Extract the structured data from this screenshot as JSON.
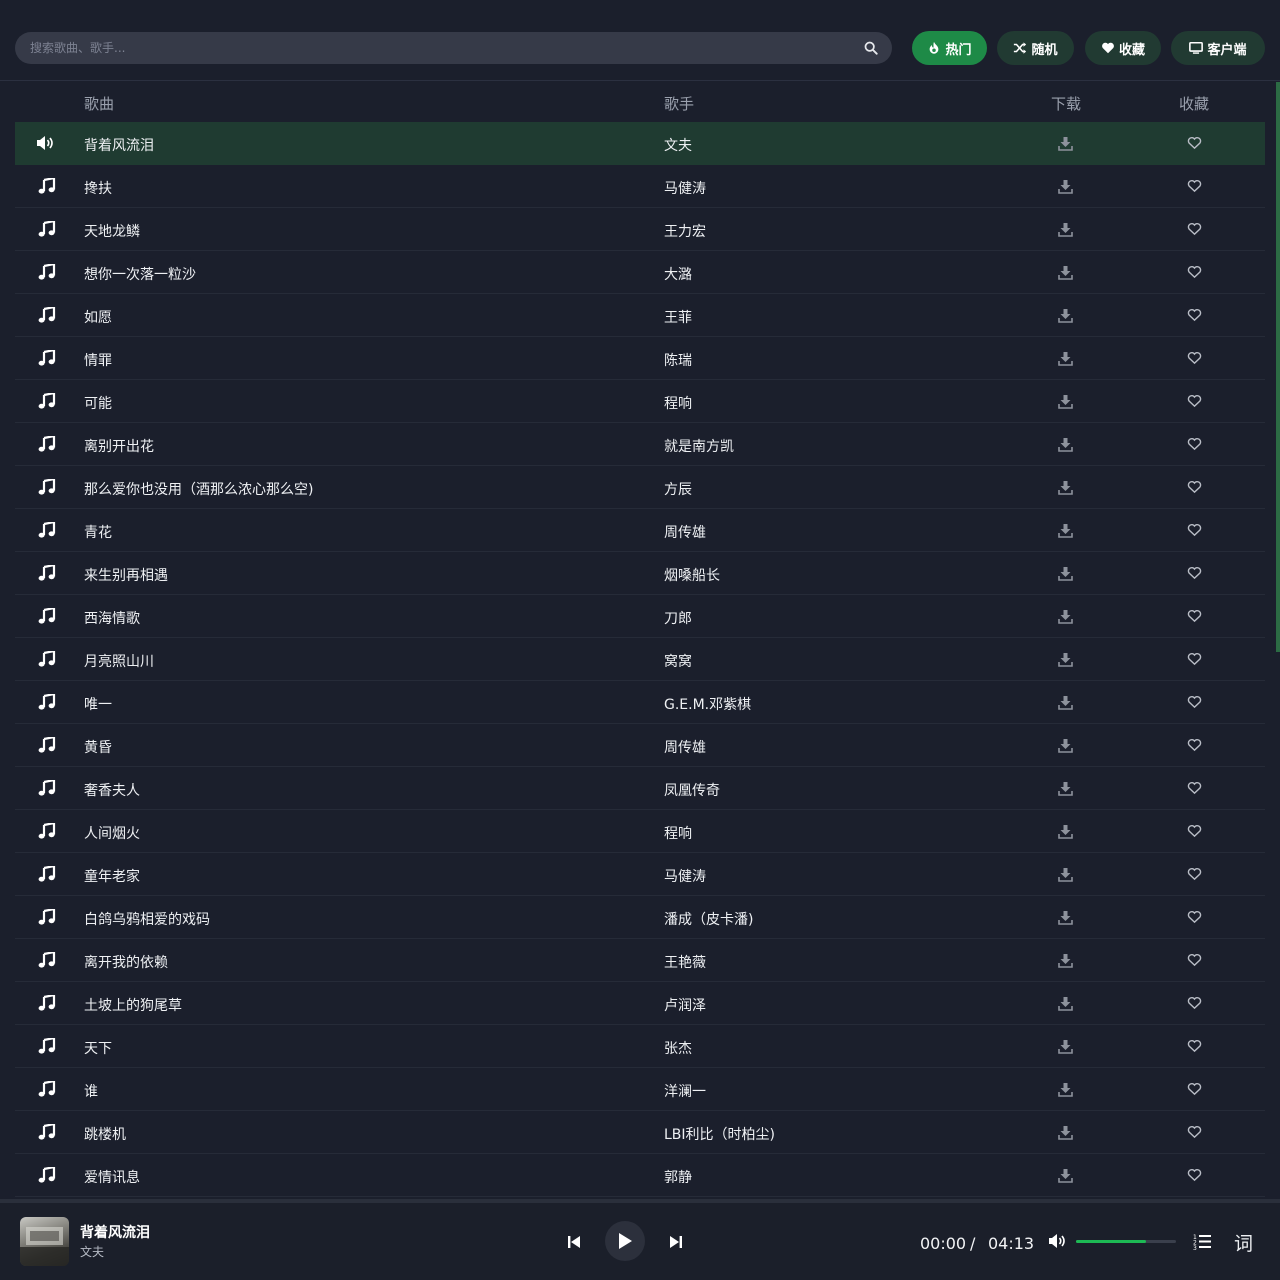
{
  "search": {
    "placeholder": "搜索歌曲、歌手..."
  },
  "nav": [
    {
      "label": "热门",
      "icon": "fire-icon",
      "active": true
    },
    {
      "label": "随机",
      "icon": "shuffle-icon",
      "active": false
    },
    {
      "label": "收藏",
      "icon": "heart-icon",
      "active": false
    },
    {
      "label": "客户端",
      "icon": "monitor-icon",
      "active": false
    }
  ],
  "columns": {
    "song": "歌曲",
    "artist": "歌手",
    "download": "下载",
    "favorite": "收藏"
  },
  "songs": [
    {
      "title": "背着风流泪",
      "artist": "文夫",
      "playing": true
    },
    {
      "title": "搀扶",
      "artist": "马健涛"
    },
    {
      "title": "天地龙鳞",
      "artist": "王力宏"
    },
    {
      "title": "想你一次落一粒沙",
      "artist": "大潞"
    },
    {
      "title": "如愿",
      "artist": "王菲"
    },
    {
      "title": "情罪",
      "artist": "陈瑞"
    },
    {
      "title": "可能",
      "artist": "程响"
    },
    {
      "title": "离别开出花",
      "artist": "就是南方凯"
    },
    {
      "title": "那么爱你也没用（酒那么浓心那么空)",
      "artist": "方辰"
    },
    {
      "title": "青花",
      "artist": "周传雄"
    },
    {
      "title": "来生别再相遇",
      "artist": "烟嗓船长"
    },
    {
      "title": "西海情歌",
      "artist": "刀郎"
    },
    {
      "title": "月亮照山川",
      "artist": "窝窝"
    },
    {
      "title": "唯一",
      "artist": "G.E.M.邓紫棋"
    },
    {
      "title": "黄昏",
      "artist": "周传雄"
    },
    {
      "title": "奢香夫人",
      "artist": "凤凰传奇"
    },
    {
      "title": "人间烟火",
      "artist": "程响"
    },
    {
      "title": "童年老家",
      "artist": "马健涛"
    },
    {
      "title": "白鸽乌鸦相爱的戏码",
      "artist": "潘成（皮卡潘)"
    },
    {
      "title": "离开我的依赖",
      "artist": "王艳薇"
    },
    {
      "title": "土坡上的狗尾草",
      "artist": "卢润泽"
    },
    {
      "title": "天下",
      "artist": "张杰"
    },
    {
      "title": "谁",
      "artist": "洋澜一"
    },
    {
      "title": "跳楼机",
      "artist": "LBI利比（时柏尘)"
    },
    {
      "title": "爱情讯息",
      "artist": "郭静"
    }
  ],
  "player": {
    "title": "背着风流泪",
    "artist": "文夫",
    "current_time": "00:00",
    "separator": "/",
    "duration": "04:13",
    "volume": 0.7,
    "lyric_label": "词"
  },
  "colors": {
    "accent": "#1e8a47",
    "background": "#1b1f2c",
    "playing_row": "#1f3b31"
  }
}
